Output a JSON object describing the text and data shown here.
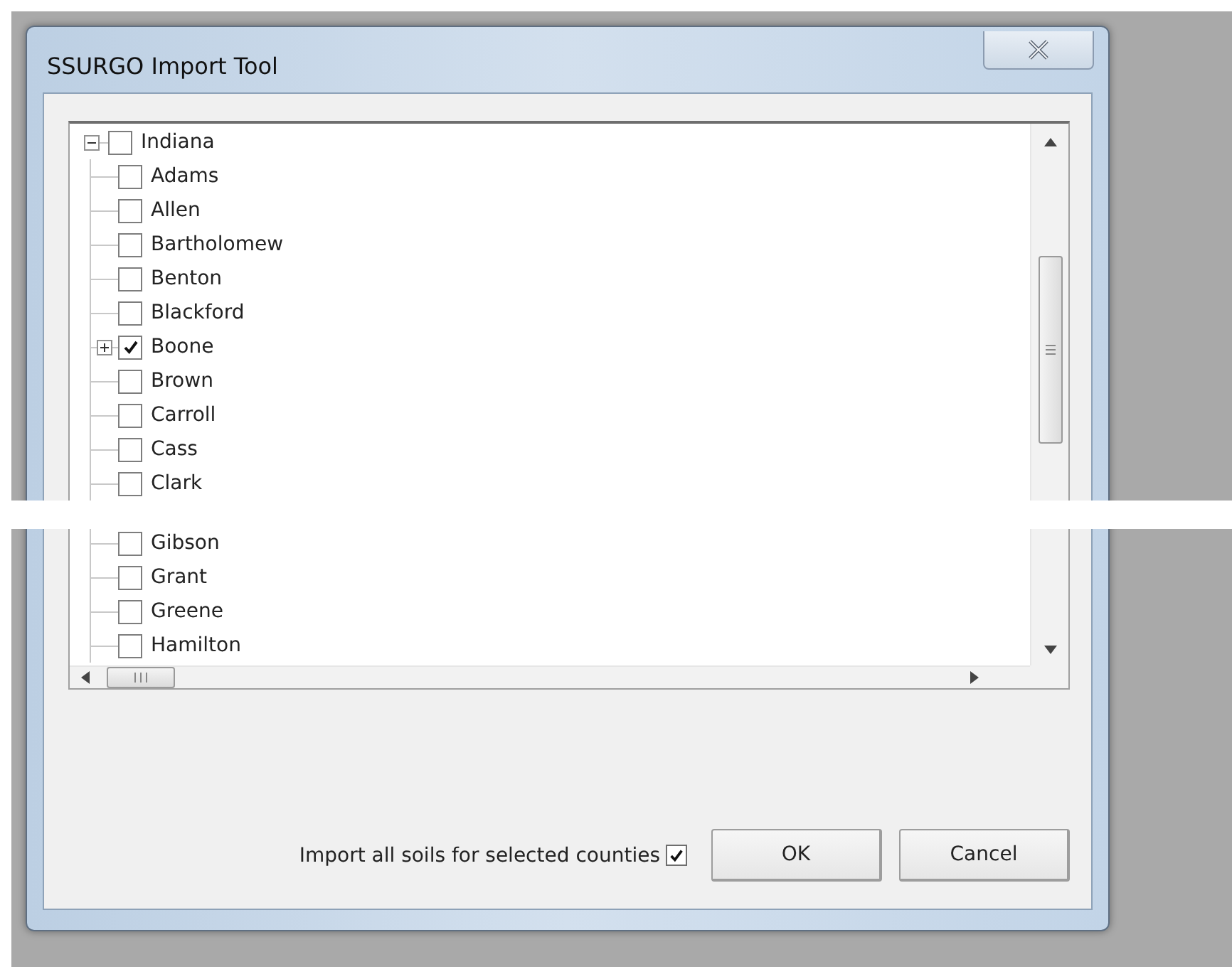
{
  "window": {
    "title": "SSURGO Import Tool"
  },
  "tree": {
    "label": "Indiana",
    "checked": false,
    "expanded": true,
    "children": [
      {
        "kind": "county",
        "label": "Adams",
        "checked": false
      },
      {
        "kind": "county",
        "label": "Allen",
        "checked": false
      },
      {
        "kind": "county",
        "label": "Bartholomew",
        "checked": false
      },
      {
        "kind": "county",
        "label": "Benton",
        "checked": false
      },
      {
        "kind": "county",
        "label": "Blackford",
        "checked": false
      },
      {
        "kind": "county",
        "label": "Boone",
        "checked": true,
        "expanded": false
      },
      {
        "kind": "county",
        "label": "Brown",
        "checked": false
      },
      {
        "kind": "county",
        "label": "Carroll",
        "checked": false
      },
      {
        "kind": "county",
        "label": "Cass",
        "checked": false
      },
      {
        "kind": "county",
        "label": "Clark",
        "checked": false
      },
      {
        "kind": "blank_band"
      },
      {
        "kind": "county",
        "label": "Gibson",
        "checked": false
      },
      {
        "kind": "county",
        "label": "Grant",
        "checked": false
      },
      {
        "kind": "county",
        "label": "Greene",
        "checked": false
      },
      {
        "kind": "county",
        "label": "Hamilton",
        "checked": false
      }
    ]
  },
  "import_all": {
    "label": "Import all soils for selected counties",
    "checked": true
  },
  "buttons": [
    {
      "label": "OK"
    },
    {
      "label": "Cancel"
    }
  ]
}
